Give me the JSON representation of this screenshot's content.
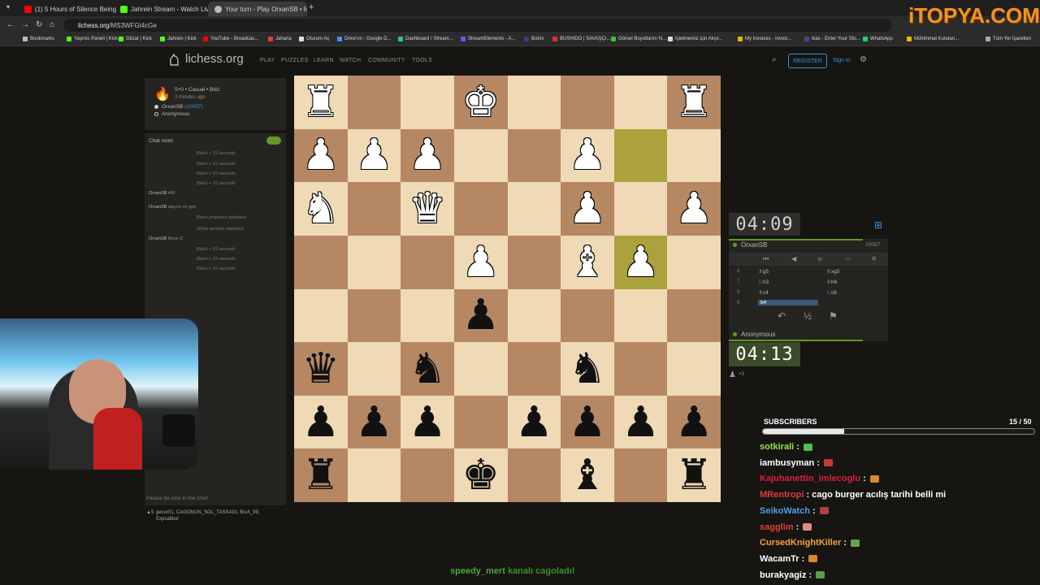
{
  "browser": {
    "tabs": [
      {
        "label": "(1) 5 Hours of Silence Being Ra",
        "color": "#ff0000",
        "active": false
      },
      {
        "label": "Jahrein Stream - Watch Live on",
        "color": "#53fc18",
        "active": false
      },
      {
        "label": "Your turn - Play OrxanSB • liche",
        "color": "#bababa",
        "active": true
      }
    ],
    "url_host": "lichess.org",
    "url_path": "/MS3WFGt4cGe",
    "bookmarks": [
      "Bookmarks",
      "Yayıncı Paneli | Kick",
      "Gitzat | Kick",
      "Jahrein | Kick",
      "YouTube - Broadcas...",
      "Jaharia",
      "Oturum Aç",
      "Drive'ım - Google D...",
      "Dashboard / Stream...",
      "StreamElements - A...",
      "Botrix",
      "BUSHIDO | SAVAŞÇI...",
      "Görsel Boyutlarını N...",
      "İşletmemiz için Alışv...",
      "My Invoices - Invoic...",
      "ikas - Enter Your Sto...",
      "WhatsApp",
      "Mühimmat Kutuları...",
      "Tüm Yer İşaretleri"
    ]
  },
  "lichess": {
    "logo": "lichess.org",
    "nav": [
      "PLAY",
      "PUZZLES",
      "LEARN",
      "WATCH",
      "COMMUNITY",
      "TOOLS"
    ],
    "register": "REGISTER",
    "sign_in": "Sign in"
  },
  "game_info": {
    "mode": "5+0 • Casual • Blitz",
    "time_ago": "3 minutes ago",
    "white_player": "OrxanSB",
    "white_rating": "(10057)",
    "black_player": "Anonymous"
  },
  "chat": {
    "title": "Chat room",
    "lines": [
      {
        "user": "",
        "text": "Black + 15 seconds",
        "system": true
      },
      {
        "user": "",
        "text": "Black + 15 seconds",
        "system": true
      },
      {
        "user": "",
        "text": "Black + 15 seconds",
        "system": true
      },
      {
        "user": "",
        "text": "Black + 15 seconds",
        "system": true
      },
      {
        "user": "OrxanSB",
        "text": "ABI",
        "system": false
      },
      {
        "user": "OrxanSB",
        "text": "alayım mı geri",
        "system": false
      },
      {
        "user": "",
        "text": "Black proposes takeback",
        "system": true
      },
      {
        "user": "",
        "text": "White accepts takeback",
        "system": true
      },
      {
        "user": "OrxanSB",
        "text": "Bora<3",
        "system": false
      },
      {
        "user": "",
        "text": "Black + 15 seconds",
        "system": true
      },
      {
        "user": "",
        "text": "Black + 15 seconds",
        "system": true
      },
      {
        "user": "",
        "text": "Black + 15 seconds",
        "system": true
      }
    ],
    "placeholder": "Please be nice in the chat!",
    "spectators_count": "5",
    "spectators": "gecur01, CAGONUN_SOL_TASSAGI, Bruh_99,",
    "spectators_more": "Expcalibur"
  },
  "board": {
    "rows": [
      [
        "wR",
        "",
        "",
        "wK",
        "",
        "",
        "",
        "wR"
      ],
      [
        "wP",
        "wP",
        "wP",
        "",
        "",
        "wP",
        "",
        "",
        ""
      ],
      [
        "wN",
        "",
        "wQ",
        "",
        "",
        "wP",
        "",
        "wP"
      ],
      [
        "",
        "",
        "",
        "wP",
        "",
        "wB",
        "wP",
        ""
      ],
      [
        "",
        "",
        "",
        "bP",
        "",
        "",
        "",
        ""
      ],
      [
        "bQ",
        "",
        "bN",
        "",
        "",
        "bN",
        "",
        ""
      ],
      [
        "bP",
        "bP",
        "bP",
        "",
        "bP",
        "bP",
        "bP",
        "bP"
      ],
      [
        "bR",
        "",
        "",
        "bK",
        "",
        "bB",
        "",
        "bR"
      ]
    ],
    "highlight": [
      [
        1,
        6
      ],
      [
        3,
        6
      ]
    ]
  },
  "clock": {
    "top_time": "04:09",
    "bottom_time": "04:13",
    "top_player": "OrxanSB",
    "top_rating": "10057",
    "bottom_player": "Anonymous",
    "bottom_extra": "+3",
    "draw_symbol": "½"
  },
  "moves": [
    {
      "num": "6",
      "white": "♗g5",
      "black": "♕xg5"
    },
    {
      "num": "7",
      "white": "♘h3",
      "black": "♕h6"
    },
    {
      "num": "8",
      "white": "♗c4",
      "black": "♘c6"
    },
    {
      "num": "9",
      "white": "b4",
      "black": ""
    }
  ],
  "overlay": {
    "subs_label": "SUBSCRIBERS",
    "subs_count": "15 / 50",
    "subs_progress": 0.3,
    "messages": [
      {
        "user": "sotkirali",
        "color": "#9be34a",
        "text": ""
      },
      {
        "user": "iambusyman",
        "color": "#ffffff",
        "text": ""
      },
      {
        "user": "Kajuhanettin_imlecoglu",
        "color": "#d7213c",
        "text": ""
      },
      {
        "user": "MRentropi",
        "color": "#e23d3d",
        "text": "cago burger acılış tarihi belli mi"
      },
      {
        "user": "SeikoWatch",
        "color": "#4e9ee8",
        "text": ""
      },
      {
        "user": "sagglim",
        "color": "#e23d3d",
        "text": ""
      },
      {
        "user": "CursedKnightKiller",
        "color": "#f2a33a",
        "text": ""
      },
      {
        "user": "WacamTr",
        "color": "#ffffff",
        "text": ""
      },
      {
        "user": "burakyagiz",
        "color": "#ffffff",
        "text": ""
      }
    ],
    "banner_user": "speedy_mert",
    "banner_text": "kanalı cagoladı!",
    "watermark": "iTOPYA.COM"
  }
}
